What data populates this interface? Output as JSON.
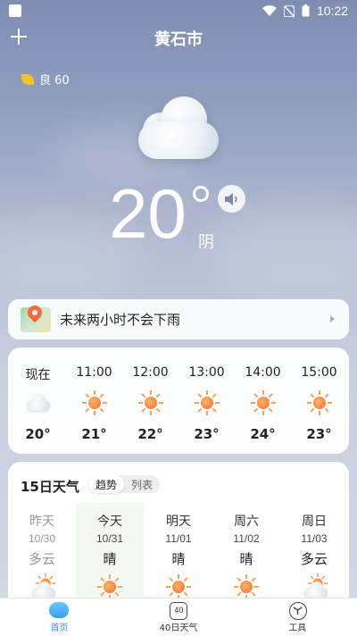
{
  "status": {
    "time": "10:22"
  },
  "header": {
    "city": "黄石市"
  },
  "aqi": {
    "label": "良 60"
  },
  "current": {
    "temp": "20",
    "condition": "阴"
  },
  "rain_banner": {
    "text": "未来两小时不会下雨"
  },
  "hourly": [
    {
      "time": "现在",
      "icon": "cloudy-icon",
      "temp": "20°"
    },
    {
      "time": "11:00",
      "icon": "sun-icon",
      "temp": "21°"
    },
    {
      "time": "12:00",
      "icon": "sun-icon",
      "temp": "22°"
    },
    {
      "time": "13:00",
      "icon": "sun-icon",
      "temp": "23°"
    },
    {
      "time": "14:00",
      "icon": "sun-icon",
      "temp": "24°"
    },
    {
      "time": "15:00",
      "icon": "sun-icon",
      "temp": "23°"
    }
  ],
  "daily": {
    "title": "15日天气",
    "toggle": [
      "趋势",
      "列表"
    ],
    "days": [
      {
        "name": "昨天",
        "date": "10/30",
        "cond": "多云",
        "icon": "partly-cloudy-icon"
      },
      {
        "name": "今天",
        "date": "10/31",
        "cond": "晴",
        "icon": "sun-icon"
      },
      {
        "name": "明天",
        "date": "11/01",
        "cond": "晴",
        "icon": "sun-icon"
      },
      {
        "name": "周六",
        "date": "11/02",
        "cond": "晴",
        "icon": "sun-icon"
      },
      {
        "name": "周日",
        "date": "11/03",
        "cond": "多云",
        "icon": "partly-cloudy-icon"
      }
    ]
  },
  "tabs": [
    {
      "label": "首页",
      "icon": "home-cloud-icon"
    },
    {
      "label": "40日天气",
      "icon": "calendar-40-icon",
      "badge": "40"
    },
    {
      "label": "工具",
      "icon": "tools-icon"
    }
  ]
}
